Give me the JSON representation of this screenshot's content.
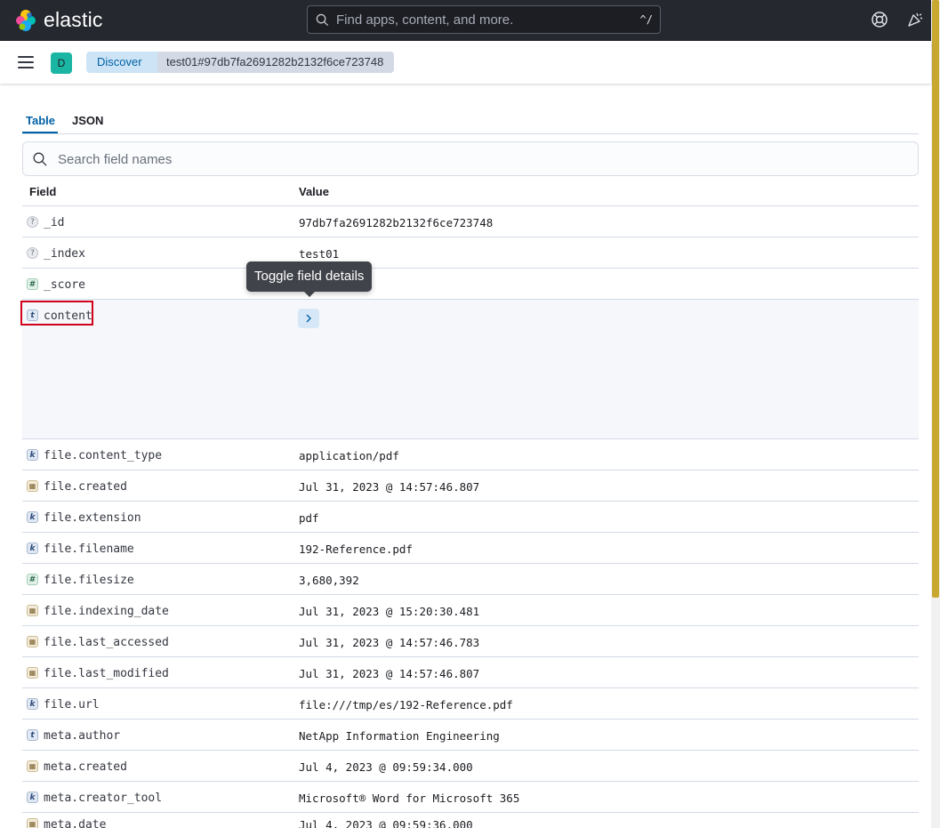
{
  "topbar": {
    "brand": "elastic",
    "search_placeholder": "Find apps, content, and more.",
    "shortcut": "^/",
    "help_icon": "help-icon",
    "news_icon": "newsfeed-icon"
  },
  "subbar": {
    "space_initial": "D",
    "breadcrumbs": [
      "Discover",
      "test01#97db7fa2691282b2132f6ce723748"
    ]
  },
  "tabs": [
    "Table",
    "JSON"
  ],
  "active_tab": "Table",
  "field_search_placeholder": "Search field names",
  "table": {
    "headers": {
      "field": "Field",
      "value": "Value"
    },
    "rows": [
      {
        "type": "unknown",
        "icon": "?",
        "field": "_id",
        "value": "97db7fa2691282b2132f6ce723748"
      },
      {
        "type": "unknown",
        "icon": "?",
        "field": "_index",
        "value": "test01"
      },
      {
        "type": "number",
        "icon": "#",
        "field": "_score",
        "value": ""
      },
      {
        "type": "text",
        "icon": "t",
        "field": "content",
        "value": ""
      },
      {
        "type": "keyword",
        "icon": "k",
        "field": "file.content_type",
        "value": "application/pdf"
      },
      {
        "type": "date",
        "icon": "▦",
        "field": "file.created",
        "value": "Jul 31, 2023 @ 14:57:46.807"
      },
      {
        "type": "keyword",
        "icon": "k",
        "field": "file.extension",
        "value": "pdf"
      },
      {
        "type": "keyword",
        "icon": "k",
        "field": "file.filename",
        "value": "192-Reference.pdf"
      },
      {
        "type": "number",
        "icon": "#",
        "field": "file.filesize",
        "value": "3,680,392"
      },
      {
        "type": "date",
        "icon": "▦",
        "field": "file.indexing_date",
        "value": "Jul 31, 2023 @ 15:20:30.481"
      },
      {
        "type": "date",
        "icon": "▦",
        "field": "file.last_accessed",
        "value": "Jul 31, 2023 @ 14:57:46.783"
      },
      {
        "type": "date",
        "icon": "▦",
        "field": "file.last_modified",
        "value": "Jul 31, 2023 @ 14:57:46.807"
      },
      {
        "type": "keyword",
        "icon": "k",
        "field": "file.url",
        "value": "file:///tmp/es/192-Reference.pdf"
      },
      {
        "type": "text",
        "icon": "t",
        "field": "meta.author",
        "value": "NetApp Information Engineering"
      },
      {
        "type": "date",
        "icon": "▦",
        "field": "meta.created",
        "value": "Jul 4, 2023 @ 09:59:34.000"
      },
      {
        "type": "keyword",
        "icon": "k",
        "field": "meta.creator_tool",
        "value": "Microsoft® Word for Microsoft 365"
      },
      {
        "type": "date",
        "icon": "▦",
        "field": "meta.date",
        "value": "Jul 4, 2023 @ 09:59:36.000"
      }
    ]
  },
  "tooltip": "Toggle field details",
  "colors": {
    "topbar": "#25282f",
    "accent": "#0061a6",
    "highlight": "#d0021b",
    "space_avatar": "#1bb5a3"
  }
}
